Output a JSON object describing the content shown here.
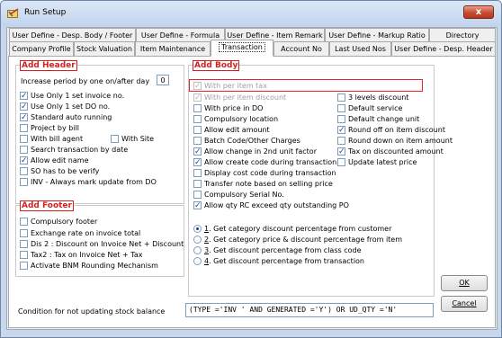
{
  "window": {
    "title": "Run Setup",
    "close_label": "x"
  },
  "tabs_row1": [
    "User Define - Desp. Body / Footer",
    "User Define - Formula",
    "User Define - Item Remark",
    "User Define - Markup Ratio",
    "Directory"
  ],
  "tabs_row2": [
    "Company Profile",
    "Stock Valuation",
    "Item Maintenance",
    "Transaction",
    "Account No",
    "Last Used Nos",
    "User Define - Desp. Header"
  ],
  "active_tab": "Transaction",
  "header_group": {
    "title": "Add Header",
    "increase_label": "Increase period by one on/after day",
    "increase_value": "0",
    "items": [
      {
        "label": "Use Only 1 set invoice no.",
        "checked": true
      },
      {
        "label": "Use Only 1 set DO no.",
        "checked": true
      },
      {
        "label": "Standard auto running",
        "checked": true
      },
      {
        "label": "Project by bill",
        "checked": false
      },
      {
        "label": "With bill agent",
        "checked": false
      },
      {
        "label": "Search transaction by date",
        "checked": false
      },
      {
        "label": "Allow edit name",
        "checked": true
      },
      {
        "label": "SO has to be verify",
        "checked": false
      },
      {
        "label": "INV - Always mark update from DO",
        "checked": false
      }
    ],
    "with_site": {
      "label": "With Site",
      "checked": false
    }
  },
  "footer_group": {
    "title": "Add Footer",
    "items": [
      {
        "label": "Compulsory footer",
        "checked": false
      },
      {
        "label": "Exchange rate on invoice total",
        "checked": false
      },
      {
        "label": "Dis 2 : Discount on Invoice Net + Discount",
        "checked": false
      },
      {
        "label": "Tax2 : Tax on Invoice Net + Tax",
        "checked": false
      },
      {
        "label": "Activate BNM Rounding Mechanism",
        "checked": false
      }
    ]
  },
  "body_group": {
    "title": "Add Body",
    "left_items": [
      {
        "label": "With per item tax",
        "checked": true,
        "disabled": true
      },
      {
        "label": "With per item discount",
        "checked": true,
        "disabled": true
      },
      {
        "label": "With price in DO",
        "checked": false
      },
      {
        "label": "Compulsory location",
        "checked": false
      },
      {
        "label": "Allow edit amount",
        "checked": false
      },
      {
        "label": "Batch Code/Other Charges",
        "checked": false
      },
      {
        "label": "Allow change in 2nd unit factor",
        "checked": true
      },
      {
        "label": "Allow create code during transaction",
        "checked": true
      },
      {
        "label": "Display cost code during transaction",
        "checked": false
      },
      {
        "label": "Transfer note based on selling price",
        "checked": false
      },
      {
        "label": "Compulsory Serial No.",
        "checked": false
      },
      {
        "label": "Allow qty RC exceed qty outstanding PO",
        "checked": true
      }
    ],
    "right_items": [
      {
        "label": "3 levels discount",
        "checked": false
      },
      {
        "label": "Default service",
        "checked": false
      },
      {
        "label": "Default change unit",
        "checked": false
      },
      {
        "label": "Round off on item discount",
        "checked": true
      },
      {
        "label": "Round down on item amount",
        "checked": false
      },
      {
        "label": "Tax on discounted amount",
        "checked": true
      },
      {
        "label": "Update latest price",
        "checked": false
      }
    ],
    "radios": [
      {
        "num": "1",
        "label": ". Get category discount percentage from customer",
        "selected": true
      },
      {
        "num": "2",
        "label": ". Get category price & discount percentage from item",
        "selected": false
      },
      {
        "num": "3",
        "label": ". Get discount percentage from class code",
        "selected": false
      },
      {
        "num": "4",
        "label": ". Get discount percentage from transaction",
        "selected": false
      }
    ]
  },
  "condition": {
    "label": "Condition for not updating stock balance",
    "value": "(TYPE ='INV ' AND GENERATED ='Y') OR UD_QTY ='N'"
  },
  "buttons": {
    "ok": "OK",
    "cancel": "Cancel"
  },
  "check_glyph": "✓"
}
